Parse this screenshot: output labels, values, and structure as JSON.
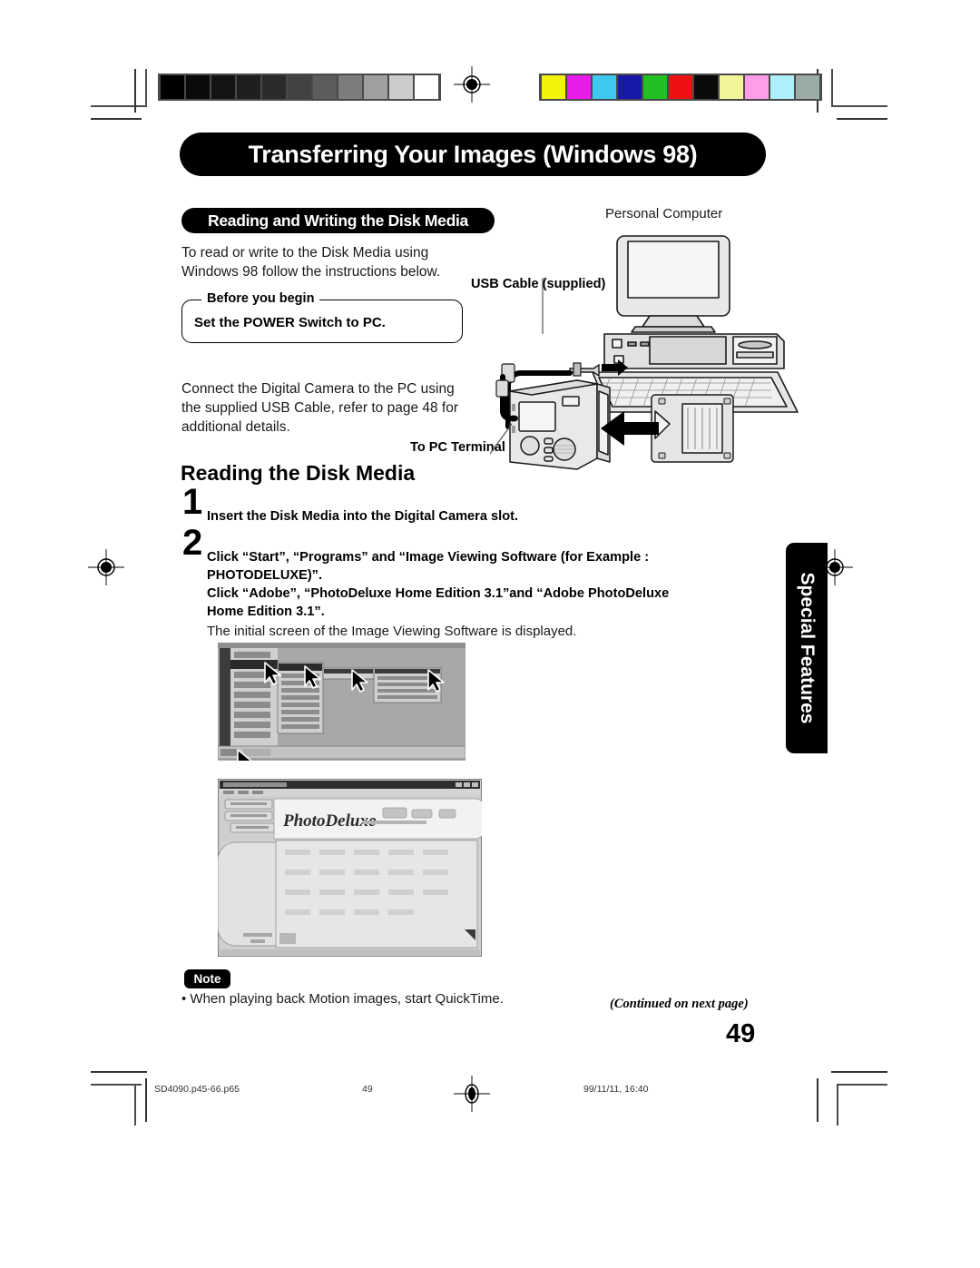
{
  "page": {
    "title_banner": "Transferring Your Images (Windows 98)",
    "section_banner": "Reading and Writing the Disk Media",
    "intro_line1": "To read or write to the Disk Media using",
    "intro_line2": "Windows 98 follow the instructions below.",
    "before_legend": "Before you begin",
    "before_body": "Set the POWER Switch to PC.",
    "connect_line1": "Connect the Digital Camera to the PC using",
    "connect_line2": "the supplied USB Cable, refer to page 48 for",
    "connect_line3": "additional  details.",
    "reading_heading": "Reading the Disk Media",
    "side_tab": "Special Features",
    "page_number": "49",
    "continued": "(Continued on next page)"
  },
  "steps": [
    {
      "number": "1",
      "lines": [
        "Insert the Disk Media into the Digital Camera slot."
      ],
      "subtext": ""
    },
    {
      "number": "2",
      "lines": [
        "Click “Start”, “Programs” and “Image Viewing Software (for Example :",
        "PHOTODELUXE)”.",
        "Click “Adobe”, “PhotoDeluxe Home Edition 3.1”and “Adobe PhotoDeluxe",
        "Home Edition 3.1”."
      ],
      "subtext": "The initial screen of the Image Viewing Software is displayed."
    }
  ],
  "note": {
    "badge": "Note",
    "bullet": "• When playing back Motion images, start QuickTime."
  },
  "diagram": {
    "pc_label": "Personal Computer",
    "usb_label": "USB Cable (supplied)",
    "terminal_label": "To PC Terminal"
  },
  "footer": {
    "filename": "SD4090.p45-66.p65",
    "page": "49",
    "timestamp": "99/11/11, 16:40"
  },
  "colorbars": {
    "grayscale": [
      "#000000",
      "#0a0a0a",
      "#141414",
      "#1f1f1f",
      "#2b2b2b",
      "#424242",
      "#5c5c5c",
      "#7d7d7d",
      "#a0a0a0",
      "#cccccc",
      "#ffffff"
    ],
    "color": [
      "#f2f20a",
      "#e81ce8",
      "#3ec8f0",
      "#1818a8",
      "#22c022",
      "#ee1111",
      "#0a0a0a",
      "#f4f49a",
      "#ff9de8",
      "#aef0fa",
      "#9aaba8"
    ]
  }
}
